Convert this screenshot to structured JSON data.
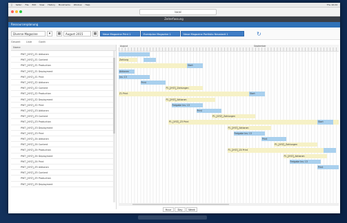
{
  "menubar": {
    "items": [
      "Safari",
      "File",
      "Edit",
      "View",
      "History",
      "Bookmarks",
      "Window",
      "Help"
    ],
    "status": "Thu 10:24"
  },
  "browser": {
    "url": "local",
    "tab_title": "Zeiterfassung"
  },
  "app": {
    "title": "Ressourcenplanung"
  },
  "controls": {
    "resource_select": "Diverse Magazine",
    "month_select": "August 2015",
    "tabs": [
      "Neue Magazine Print 1",
      "Eventplan Magazine 1",
      "Neue Magazine Portfolio Neustadt 1"
    ]
  },
  "view_tabs": [
    "Gesamt",
    "Liste",
    "Gantt"
  ],
  "left": {
    "header": "Name",
    "rows": [
      "PWT_[XYZ]_Z1 Aktionen",
      "PWT_[XYZ]_Z1 Content",
      "PWT_[XYZ]_Z1 Production",
      "PWT_[XYZ]_Z1 Deployment",
      "PWT_[XYZ]_Z1 Print",
      "PWT_[XYZ]_Z2 Aktionen",
      "PWT_[XYZ]_Z2 Content",
      "PWT_[XYZ]_Z2 Production",
      "PWT_[XYZ]_Z2 Deployment",
      "PWT_[XYZ]_Z2 Print",
      "PWT_[XYZ]_Z3 Aktionen",
      "PWT_[XYZ]_Z3 Content",
      "PWT_[XYZ]_Z3 Production",
      "PWT_[XYZ]_Z3 Deployment",
      "PWT_[XYZ]_Z3 Print",
      "PWT_[XYZ]_Z4 Aktionen",
      "PWT_[XYZ]_Z4 Content",
      "PWT_[XYZ]_Z4 Production",
      "PWT_[XYZ]_Z4 Deployment",
      "PWT_[XYZ]_Z4 Print",
      "PWT_[XYZ]_Z5 Aktionen",
      "PWT_[XYZ]_Z5 Content",
      "PWT_[XYZ]_Z5 Production",
      "PWT_[XYZ]_Z5 Deployment"
    ]
  },
  "gantt": {
    "months": [
      "August",
      "September"
    ],
    "bars": [
      {
        "row": 0,
        "start": 0,
        "len": 10,
        "c": "b",
        "label": ""
      },
      {
        "row": 0,
        "start": 7,
        "len": 3,
        "c": "b",
        "label": ""
      },
      {
        "row": 1,
        "start": 0,
        "len": 6,
        "c": "y",
        "label": "Zahlung"
      },
      {
        "row": 1,
        "start": 8,
        "len": 4,
        "c": "b",
        "label": ""
      },
      {
        "row": 2,
        "start": 0,
        "len": 24,
        "c": "y",
        "label": ""
      },
      {
        "row": 2,
        "start": 22,
        "len": 5,
        "c": "b",
        "label": "Start"
      },
      {
        "row": 3,
        "start": 0,
        "len": 5,
        "c": "b",
        "label": "Aktionen"
      },
      {
        "row": 4,
        "start": 0,
        "len": 10,
        "c": "b",
        "label": "Ins: 13"
      },
      {
        "row": 5,
        "start": 7,
        "len": 8,
        "c": "b",
        "label": "Print"
      },
      {
        "row": 6,
        "start": 15,
        "len": 12,
        "c": "y",
        "label": "P1_[XYZ]_Zahlungen"
      },
      {
        "row": 7,
        "start": 0,
        "len": 44,
        "c": "y",
        "label": "Z1 Print"
      },
      {
        "row": 7,
        "start": 42,
        "len": 5,
        "c": "b",
        "label": "Start"
      },
      {
        "row": 8,
        "start": 15,
        "len": 16,
        "c": "y",
        "label": "P1_[XYZ]_Aktionen"
      },
      {
        "row": 9,
        "start": 17,
        "len": 10,
        "c": "b",
        "label": "Freigabe     Ins: 13"
      },
      {
        "row": 10,
        "start": 25,
        "len": 8,
        "c": "b",
        "label": "Print"
      },
      {
        "row": 11,
        "start": 30,
        "len": 14,
        "c": "y",
        "label": "P1_[XYZ]_Zahlungen"
      },
      {
        "row": 12,
        "start": 16,
        "len": 58,
        "c": "y",
        "label": "P1_[XYZ]_Z3 Print"
      },
      {
        "row": 12,
        "start": 64,
        "len": 5,
        "c": "b",
        "label": "Start"
      },
      {
        "row": 13,
        "start": 35,
        "len": 14,
        "c": "y",
        "label": "P1_[XYZ]_Aktionen"
      },
      {
        "row": 14,
        "start": 37,
        "len": 10,
        "c": "b",
        "label": "Freigabe     Ins: 13"
      },
      {
        "row": 15,
        "start": 46,
        "len": 8,
        "c": "b",
        "label": "Print"
      },
      {
        "row": 16,
        "start": 50,
        "len": 14,
        "c": "y",
        "label": "P1_[XYZ]_Zahlungen"
      },
      {
        "row": 17,
        "start": 35,
        "len": 34,
        "c": "y",
        "label": "P1_[XYZ]_Z4 Print"
      },
      {
        "row": 17,
        "start": 66,
        "len": 4,
        "c": "b",
        "label": ""
      },
      {
        "row": 18,
        "start": 53,
        "len": 14,
        "c": "y",
        "label": "P1_[XYZ]_Aktionen"
      },
      {
        "row": 19,
        "start": 55,
        "len": 10,
        "c": "b",
        "label": "Freigabe     Ins: 13"
      },
      {
        "row": 20,
        "start": 64,
        "len": 8,
        "c": "b",
        "label": "Print"
      }
    ]
  },
  "zoom": {
    "hour": "Hour",
    "day": "Day",
    "week": "Week"
  }
}
